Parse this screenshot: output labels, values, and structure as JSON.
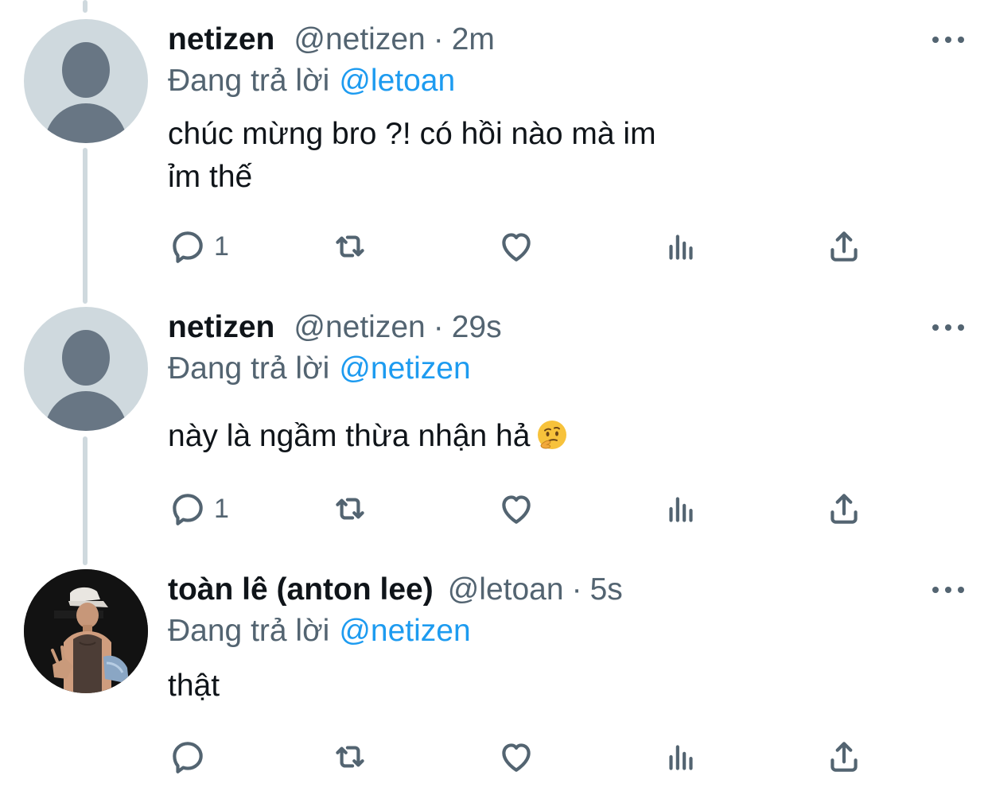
{
  "tweets": [
    {
      "display_name": "netizen",
      "handle": "@netizen",
      "separator": "·",
      "time": "2m",
      "reply_prefix": "Đang trả lời",
      "reply_to": "@letoan",
      "text_line1": "chúc mừng bro ?! có hồi nào mà im",
      "text_line2": "ỉm thế",
      "reply_count": "1",
      "avatar_icon": "default-avatar-icon"
    },
    {
      "display_name": "netizen",
      "handle": "@netizen",
      "separator": "·",
      "time": "29s",
      "reply_prefix": "Đang trả lời",
      "reply_to": "@netizen",
      "text": "này là ngầm thừa nhận hả",
      "emoji": "thinking-face-emoji",
      "reply_count": "1",
      "avatar_icon": "default-avatar-icon"
    },
    {
      "display_name": "toàn lê (anton lee)",
      "handle": "@letoan",
      "separator": "·",
      "time": "5s",
      "reply_prefix": "Đang trả lời",
      "reply_to": "@netizen",
      "text": "thật",
      "reply_count": "",
      "avatar_icon": "profile-photo"
    }
  ],
  "icons": {
    "reply": "reply-icon",
    "retweet": "retweet-icon",
    "like": "like-icon",
    "views": "views-icon",
    "share": "share-icon",
    "more": "more-icon"
  },
  "colors": {
    "text_primary": "#0f1419",
    "text_secondary": "#536471",
    "mention": "#1d9bf0",
    "thread_line": "#cfd9de",
    "avatar_default_bg": "#cfd9de",
    "avatar_default_fg": "#687684"
  }
}
